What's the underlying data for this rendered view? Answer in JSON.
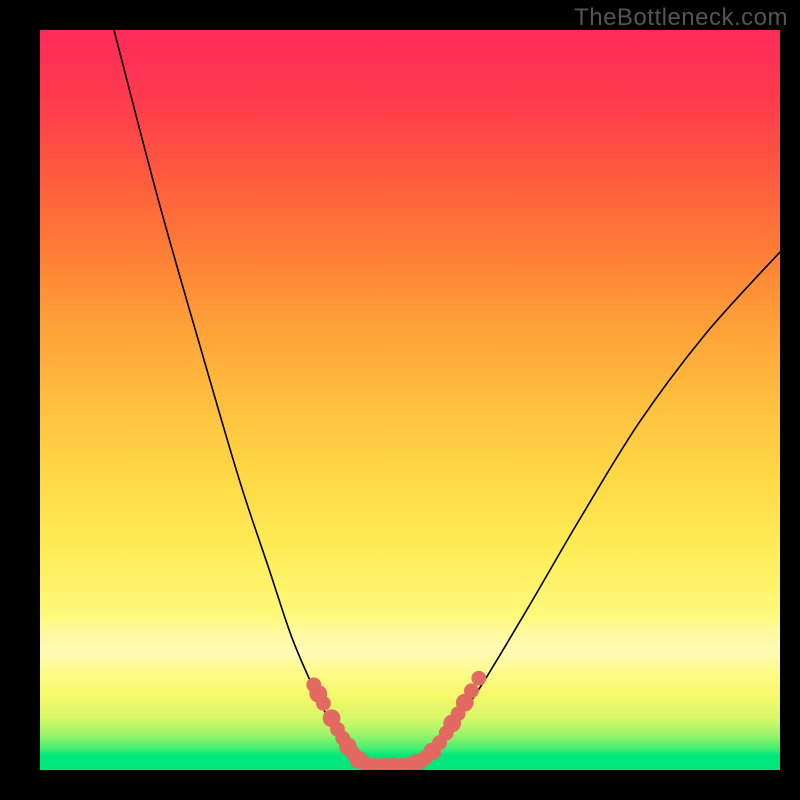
{
  "watermark": "TheBottleneck.com",
  "chart_data": {
    "type": "line",
    "title": "",
    "xlabel": "",
    "ylabel": "",
    "xlim": [
      0,
      100
    ],
    "ylim": [
      0,
      100
    ],
    "grid": false,
    "legend": false,
    "series": [
      {
        "name": "left-branch",
        "x": [
          10,
          16,
          22,
          27,
          31,
          34,
          37,
          40,
          42,
          43.5
        ],
        "y": [
          100,
          77,
          56,
          39,
          27,
          18,
          11,
          5,
          2,
          0.7
        ]
      },
      {
        "name": "right-branch",
        "x": [
          50.5,
          53,
          56,
          60,
          66,
          73,
          81,
          90,
          100
        ],
        "y": [
          0.7,
          2,
          6,
          12,
          22,
          34,
          47,
          59,
          70
        ]
      },
      {
        "name": "floor-segment",
        "x": [
          43.5,
          50.5
        ],
        "y": [
          0.7,
          0.7
        ]
      }
    ],
    "annotations": {
      "dots": [
        {
          "x": 37.0,
          "y": 11.5,
          "r": 1.0
        },
        {
          "x": 37.6,
          "y": 10.3,
          "r": 1.2
        },
        {
          "x": 38.3,
          "y": 9.0,
          "r": 1.0
        },
        {
          "x": 39.4,
          "y": 7.0,
          "r": 1.2
        },
        {
          "x": 40.2,
          "y": 5.5,
          "r": 1.0
        },
        {
          "x": 40.9,
          "y": 4.3,
          "r": 1.0
        },
        {
          "x": 41.6,
          "y": 3.2,
          "r": 1.2
        },
        {
          "x": 42.3,
          "y": 2.3,
          "r": 1.0
        },
        {
          "x": 43.0,
          "y": 1.4,
          "r": 1.2
        },
        {
          "x": 44.0,
          "y": 0.9,
          "r": 1.0
        },
        {
          "x": 45.2,
          "y": 0.7,
          "r": 1.0
        },
        {
          "x": 46.5,
          "y": 0.7,
          "r": 1.0
        },
        {
          "x": 47.8,
          "y": 0.7,
          "r": 1.0
        },
        {
          "x": 49.0,
          "y": 0.7,
          "r": 1.0
        },
        {
          "x": 50.0,
          "y": 0.8,
          "r": 1.0
        },
        {
          "x": 51.0,
          "y": 1.0,
          "r": 1.2
        },
        {
          "x": 52.0,
          "y": 1.6,
          "r": 1.0
        },
        {
          "x": 53.0,
          "y": 2.5,
          "r": 1.2
        },
        {
          "x": 54.0,
          "y": 3.7,
          "r": 1.0
        },
        {
          "x": 54.9,
          "y": 5.0,
          "r": 1.0
        },
        {
          "x": 55.7,
          "y": 6.3,
          "r": 1.2
        },
        {
          "x": 56.5,
          "y": 7.6,
          "r": 1.0
        },
        {
          "x": 57.4,
          "y": 9.1,
          "r": 1.2
        },
        {
          "x": 58.3,
          "y": 10.7,
          "r": 1.0
        },
        {
          "x": 59.3,
          "y": 12.4,
          "r": 1.0
        }
      ]
    },
    "colors": {
      "curve": "#000000",
      "dots": "#e26a60",
      "background_top": "#ff2b5a",
      "background_bottom": "#00e87b",
      "frame": "#000000"
    }
  }
}
